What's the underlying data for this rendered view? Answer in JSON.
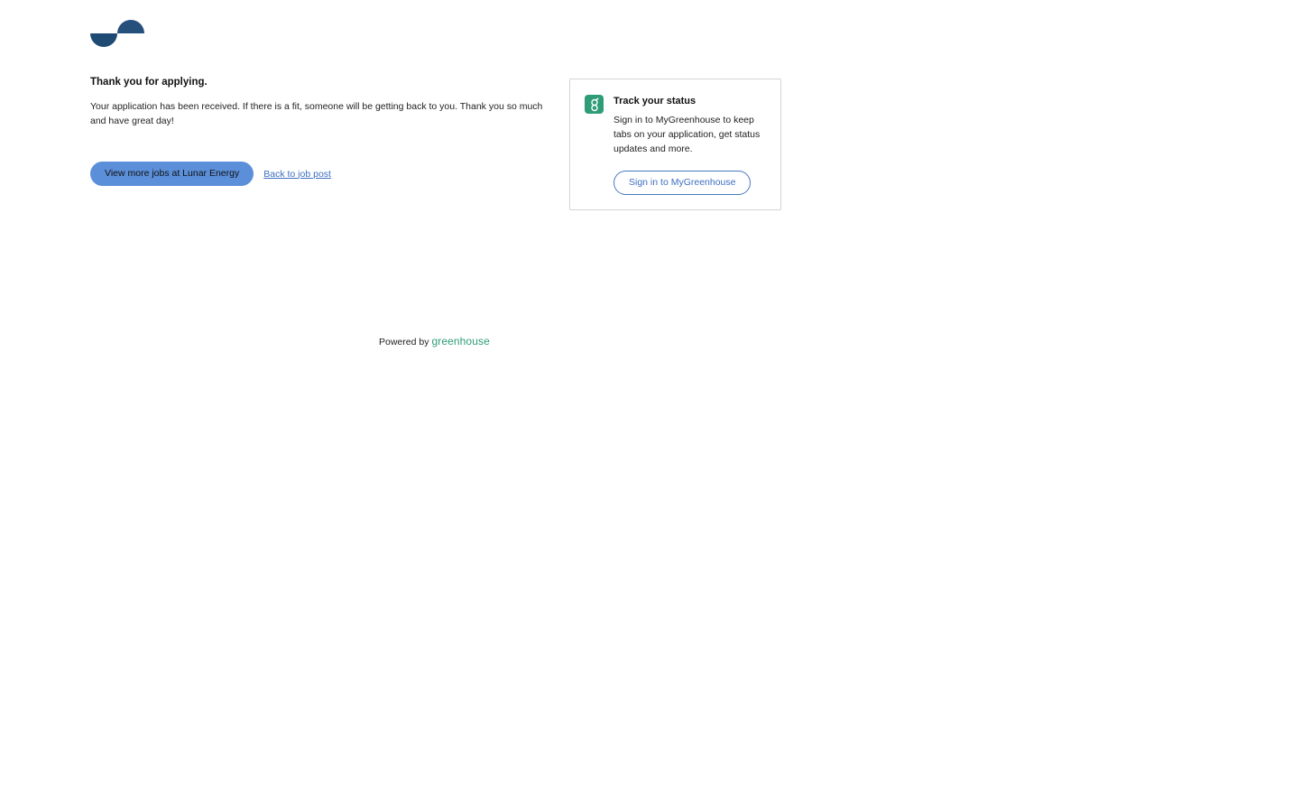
{
  "brand": {
    "logo_icon": "lunar-energy-logo-icon",
    "logo_colors": [
      "#1f4a73",
      "#26507c"
    ]
  },
  "confirmation": {
    "headline": "Thank you for applying.",
    "message": "Your application has been received. If there is a fit, someone will be getting back to you. Thank you so much and have great day!"
  },
  "actions": {
    "view_more_label": "View more jobs at Lunar Energy",
    "back_label": "Back to job post"
  },
  "status_card": {
    "icon": "greenhouse-g-icon",
    "title": "Track your status",
    "text": "Sign in to MyGreenhouse to keep tabs on your application, get status updates and more.",
    "button_label": "Sign in to MyGreenhouse"
  },
  "footer": {
    "powered_by": "Powered by",
    "wordmark": "greenhouse"
  },
  "colors": {
    "primary_button": "#5b8fd9",
    "link": "#3d6fc1",
    "greenhouse_green": "#2e9c77"
  }
}
